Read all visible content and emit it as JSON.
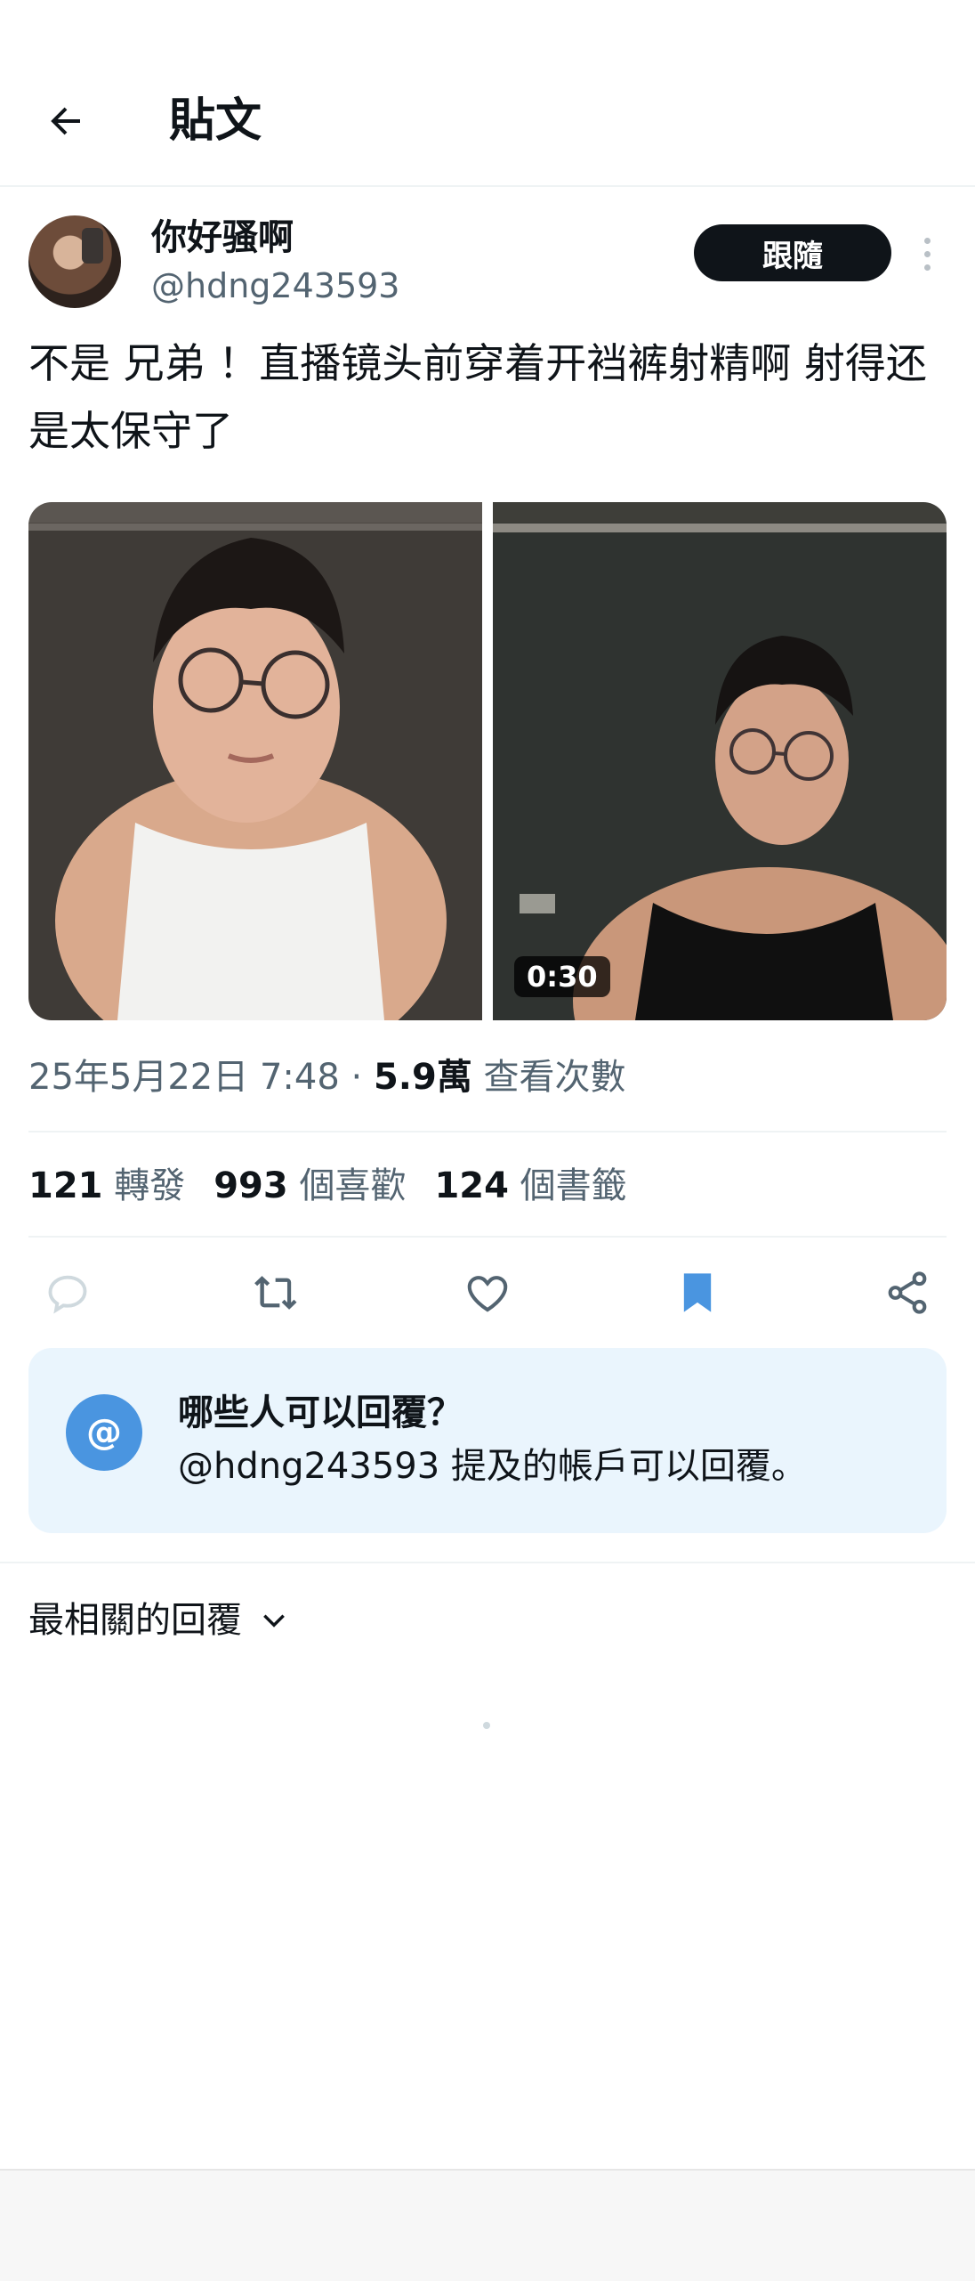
{
  "header": {
    "title": "貼文"
  },
  "author": {
    "name": "你好骚啊",
    "handle": "@hdng243593",
    "follow_label": "跟隨"
  },
  "tweet": {
    "text": "不是 兄弟 ！直播镜头前穿着开裆裤射精啊 射得还是太保守了",
    "video_duration": "0:30"
  },
  "meta": {
    "date_time": "25年5月22日 7:48",
    "separator": " · ",
    "views_count": "5.9萬",
    "views_label": " 查看次數"
  },
  "stats": [
    {
      "count": "121",
      "label": "轉發"
    },
    {
      "count": "993",
      "label": "個喜歡"
    },
    {
      "count": "124",
      "label": "個書籤"
    }
  ],
  "reply_restriction": {
    "title": "哪些人可以回覆？",
    "description": "@hdng243593 提及的帳戶可以回覆。",
    "icon_text": "@"
  },
  "replies": {
    "sort_label": "最相關的回覆"
  },
  "colors": {
    "accent": "#1d9bf0",
    "bookmark_active": "#4a95e0",
    "follow_bg": "#0f1419",
    "card_bg": "#eaf5fd"
  },
  "icons": [
    "back-arrow-icon",
    "more-vertical-icon",
    "reply-icon",
    "retweet-icon",
    "like-icon",
    "bookmark-icon",
    "share-icon",
    "chevron-down-icon"
  ]
}
